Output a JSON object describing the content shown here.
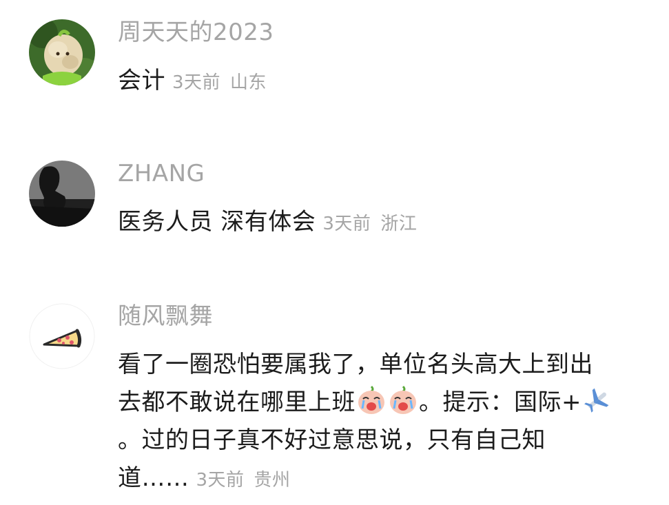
{
  "comments": [
    {
      "username": "周天天的2023",
      "text": "会计",
      "time": "3天前",
      "location": "山东",
      "avatar_icon": "plush-sheep-avatar"
    },
    {
      "username": "ZHANG",
      "text": "医务人员 深有体会",
      "time": "3天前",
      "location": "浙江",
      "avatar_icon": "silhouette-avatar"
    },
    {
      "username": "随风飘舞",
      "text_part1": "看了一圈恐怕要属我了，单位名头高大上到出去都不敢说在哪里上班",
      "text_part2": "。提示：国际+",
      "text_part3": "。过的日子真不好过意思说，只有自己知道……",
      "time": "3天前",
      "location": "贵州",
      "avatar_icon": "pizza-slice-avatar",
      "emojis": [
        "crying-peach-emoji",
        "crying-peach-emoji",
        "airplane-emoji"
      ]
    }
  ],
  "colors": {
    "muted_text": "#a5a5a5",
    "body_text": "#1c1c1c"
  }
}
